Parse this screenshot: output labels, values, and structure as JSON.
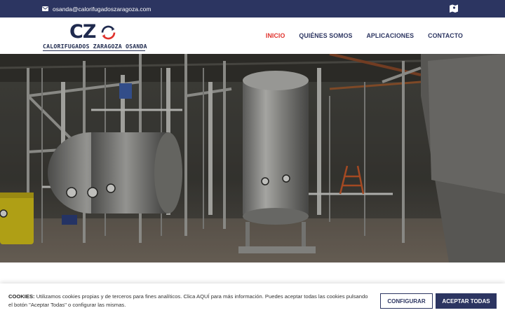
{
  "topbar": {
    "email": "osanda@calorifugadoszaragoza.com",
    "icons": {
      "mail": "envelope-icon",
      "map": "map-icon"
    }
  },
  "logo": {
    "mark": "CZ",
    "tagline": "CALORIFUGADOS ZARAGOZA OSANDA"
  },
  "nav": {
    "items": [
      {
        "label": "INICIO",
        "active": true
      },
      {
        "label": "QUIÉNES SOMOS",
        "active": false
      },
      {
        "label": "APLICACIONES",
        "active": false
      },
      {
        "label": "CONTACTO",
        "active": false
      }
    ]
  },
  "cookie": {
    "title": "COOKIES:",
    "text": "Utilizamos cookies propias y de terceros para fines analíticos. Clica AQUÍ para más información. Puedes aceptar todas las cookies pulsando el botón \"Aceptar Todas\" o configurar las mismas.",
    "configure_label": "CONFIGURAR",
    "accept_label": "ACEPTAR TODAS"
  },
  "colors": {
    "brand_navy": "#2c3561",
    "accent_red": "#e0322c"
  }
}
